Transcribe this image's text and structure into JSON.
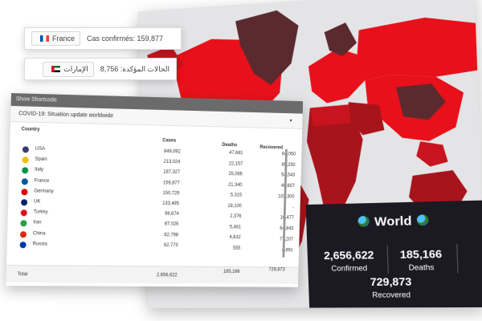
{
  "map": {
    "world_card": {
      "title": "World",
      "confirmed_value": "2,656,622",
      "confirmed_label": "Confirmed",
      "deaths_value": "185,166",
      "deaths_label": "Deaths",
      "recovered_value": "729,873",
      "recovered_label": "Recovered"
    }
  },
  "tooltips": {
    "france": {
      "country": "France",
      "text": "Cas confirmés: 159,877"
    },
    "uae": {
      "country": "الإمارات",
      "text": "الحالات المؤكدة: 8,756"
    }
  },
  "table": {
    "shortcode_label": "Show Shortcode",
    "title": "COVID-19: Situation update worldwide",
    "caret": "▾",
    "headers": {
      "country": "Country",
      "cases": "Cases",
      "deaths": "Deaths",
      "recovered": "Recovered"
    },
    "rows": [
      {
        "country": "USA",
        "cases": "849,092",
        "deaths": "47,681",
        "recovered": "84,050",
        "flag_color": "#3c3b6e"
      },
      {
        "country": "Spain",
        "cases": "213,024",
        "deaths": "22,157",
        "recovered": "89,250",
        "flag_color": "#f1bf00"
      },
      {
        "country": "Italy",
        "cases": "187,327",
        "deaths": "25,085",
        "recovered": "54,543",
        "flag_color": "#009246"
      },
      {
        "country": "France",
        "cases": "159,877",
        "deaths": "21,340",
        "recovered": "40,657",
        "flag_color": "#0055a4"
      },
      {
        "country": "Germany",
        "cases": "150,729",
        "deaths": "5,315",
        "recovered": "103,300",
        "flag_color": "#dd0000"
      },
      {
        "country": "UK",
        "cases": "133,495",
        "deaths": "18,100",
        "recovered": "-",
        "flag_color": "#012169"
      },
      {
        "country": "Turkey",
        "cases": "98,674",
        "deaths": "2,376",
        "recovered": "16,477",
        "flag_color": "#e30a17"
      },
      {
        "country": "Iran",
        "cases": "87,026",
        "deaths": "5,481",
        "recovered": "64,843",
        "flag_color": "#239f40"
      },
      {
        "country": "China",
        "cases": "82,798",
        "deaths": "4,632",
        "recovered": "77,207",
        "flag_color": "#de2910"
      },
      {
        "country": "Russia",
        "cases": "62,773",
        "deaths": "555",
        "recovered": "4,891",
        "flag_color": "#0039a6"
      }
    ],
    "total": {
      "label": "Total",
      "cases": "2,656,622",
      "deaths": "185,166",
      "recovered": "729,873"
    }
  },
  "colors": {
    "map_red": "#e8101a",
    "map_dark_red": "#a8141c",
    "map_maroon": "#5a2a2f",
    "map_background": "#e4e4e6",
    "card_background": "#1b1a23"
  }
}
